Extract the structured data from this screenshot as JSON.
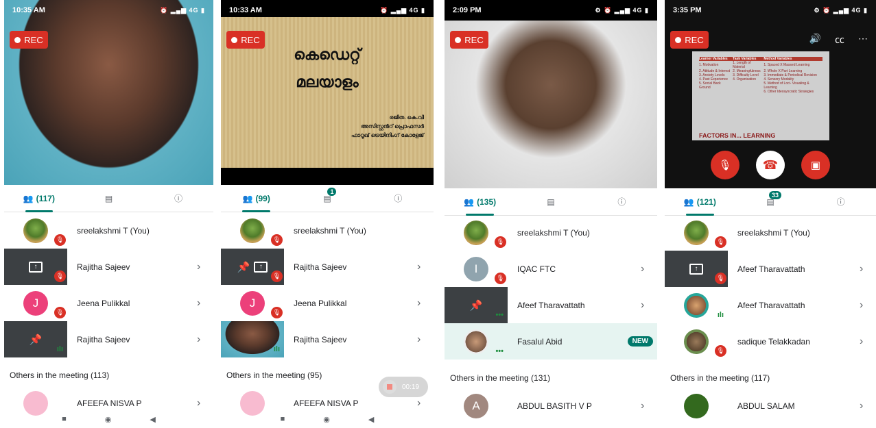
{
  "screens": [
    {
      "time": "10:35 AM",
      "status": "⏰ ▂▄▆ 4G ▮",
      "rec_label": "REC",
      "tabs": {
        "people_count": "(117)",
        "chat_badge": "",
        "people_icon": "people-icon",
        "chat_icon": "chat-icon",
        "info_icon": "info-icon"
      },
      "participants": [
        {
          "name": "sreelakshmi T (You)",
          "avatar": "tree",
          "mic": "off",
          "chevron": false
        },
        {
          "name": "Rajitha Sajeev",
          "avatar": "share",
          "mic": "off",
          "chevron": true
        },
        {
          "name": "Jeena Pulikkal",
          "avatar": "letter",
          "letter": "J",
          "color": "#ec407a",
          "mic": "off",
          "chevron": true
        },
        {
          "name": "Rajitha Sajeev",
          "avatar": "pin",
          "mic": "speaking",
          "chevron": true
        }
      ],
      "others_label": "Others in the meeting (113)",
      "others_first": {
        "name": "AFEEFA NISVA P",
        "chevron": true
      }
    },
    {
      "time": "10:33 AM",
      "status": "⏰ ▂▄▆ 4G ▮",
      "rec_label": "REC",
      "slide": {
        "title_1": "കെഡെറ്റ്",
        "title_2": "മലയാളം",
        "sub_1": "രജിത. കെ.വി",
        "sub_2": "അസിസ്റ്റൻറ് പ്രൊഫസർ",
        "sub_3": "ഫാറൂഖ് ട്രെയിനിംഗ് കോളേജ്"
      },
      "tabs": {
        "people_count": "(99)",
        "chat_badge": "1",
        "people_icon": "people-icon",
        "chat_icon": "chat-icon",
        "info_icon": "info-icon"
      },
      "participants": [
        {
          "name": "sreelakshmi T (You)",
          "avatar": "tree",
          "mic": "off",
          "chevron": false
        },
        {
          "name": "Rajitha Sajeev",
          "avatar": "share-pin",
          "mic": "off",
          "chevron": true
        },
        {
          "name": "Jeena Pulikkal",
          "avatar": "letter",
          "letter": "J",
          "color": "#ec407a",
          "mic": "off",
          "chevron": true
        },
        {
          "name": "Rajitha Sajeev",
          "avatar": "video-woman",
          "mic": "speaking",
          "chevron": true
        }
      ],
      "others_label": "Others in the meeting (95)",
      "others_first": {
        "name": "AFEEFA NISVA P",
        "chevron": true
      },
      "recording_timer": "00:19"
    },
    {
      "time": "2:09 PM",
      "status": "⚙ ⏰ ▂▄▆ 4G ▮",
      "rec_label": "REC",
      "tabs": {
        "people_count": "(135)",
        "chat_badge": "",
        "people_icon": "people-icon",
        "chat_icon": "chat-icon",
        "info_icon": "info-icon"
      },
      "participants": [
        {
          "name": "sreelakshmi T (You)",
          "avatar": "tree",
          "mic": "off",
          "chevron": false
        },
        {
          "name": "IQAC FTC",
          "avatar": "letter",
          "letter": "I",
          "color": "#90a4ae",
          "mic": "off",
          "chevron": true
        },
        {
          "name": "Afeef Tharavattath",
          "avatar": "pin",
          "mic": "dots",
          "chevron": true
        },
        {
          "name": "Fasalul Abid",
          "avatar": "photo",
          "mic": "dots",
          "chevron": false,
          "new_label": "NEW"
        }
      ],
      "others_label": "Others in the meeting (131)",
      "others_first": {
        "name": "ABDUL BASITH V P",
        "letter": "A",
        "chevron": true
      }
    },
    {
      "time": "3:35 PM",
      "status": "⚙ ⏰ ▂▄▆ 4G ▮",
      "rec_label": "REC",
      "slide_table": {
        "headers": [
          "Learner Variables",
          "Task Variables",
          "Method Variables"
        ],
        "rows": [
          [
            "1. Motivation",
            "1. Length of Material",
            "1. Spaced X Massed Learning"
          ],
          [
            "2. Attitude & Interest",
            "2. Meaningfulness",
            "2. Whole X Part Learning"
          ],
          [
            "3. Anxiety Levels",
            "3. Difficulty Level",
            "3. Immediate & Periodical Revision"
          ],
          [
            "4. Past Experience",
            "4. Organisation",
            "4. Sensory Modality"
          ],
          [
            "5. Social Back Ground",
            "",
            "5. Method of Loci- Visualing & Learning"
          ],
          [
            "",
            "",
            "6. Other Ideosyncratic Strategies"
          ]
        ],
        "footer": "FACTORS IN... LEARNING"
      },
      "tabs": {
        "people_count": "(121)",
        "chat_badge": "33",
        "people_icon": "people-icon",
        "chat_icon": "chat-icon",
        "info_icon": "info-icon"
      },
      "participants": [
        {
          "name": "sreelakshmi T (You)",
          "avatar": "tree",
          "mic": "off",
          "chevron": false
        },
        {
          "name": "Afeef Tharavattath",
          "avatar": "share",
          "mic": "off",
          "chevron": true
        },
        {
          "name": "Afeef Tharavattath",
          "avatar": "photo",
          "mic": "speaking",
          "chevron": true
        },
        {
          "name": "sadique Telakkadan",
          "avatar": "photo",
          "mic": "off",
          "chevron": true
        }
      ],
      "others_label": "Others in the meeting (117)",
      "others_first": {
        "name": "ABDUL SALAM",
        "chevron": true
      }
    }
  ],
  "colors": {
    "accent": "#00796b",
    "rec": "#d93025",
    "mic_off": "#d93025",
    "speaking": "#1e8e3e"
  }
}
